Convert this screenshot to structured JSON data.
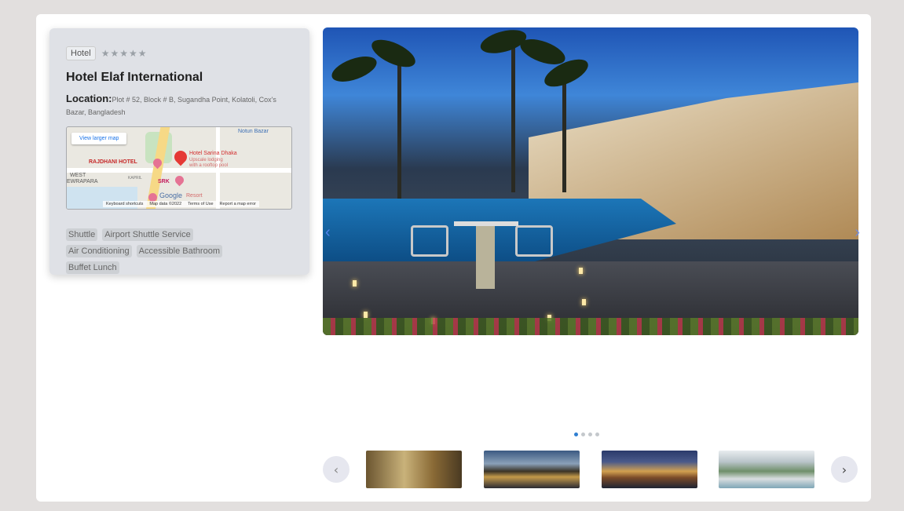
{
  "card": {
    "type_label": "Hotel",
    "stars": "★★★★★",
    "hotel_name": "Hotel Elaf International",
    "location_label": "Location:",
    "location_text": "Plot # 52, Block # B, Sugandha Point, Kolatoli, Cox's Bazar, Bangladesh",
    "map": {
      "view_larger_label": "View larger map",
      "labels": {
        "rajdhani": "RAJDHANI HOTEL",
        "sayeman_title": "Hotel Sarina Dhaka",
        "sayeman_sub1": "Upscale lodging",
        "sayeman_sub2": "with a rooftop pool",
        "srk": "SRK",
        "west": "WEST",
        "ewrapara": "EWRAPARA",
        "notun_bazar": "Notun Bazar",
        "kapril": "KAPRIL",
        "google": "Google",
        "resort": "Resort"
      },
      "footer": [
        "Keyboard shortcuts",
        "Map data ©2022",
        "Terms of Use",
        "Report a map error"
      ]
    },
    "amenities": [
      "Shuttle",
      "Airport Shuttle Service",
      "Air Conditioning",
      "Accessible Bathroom",
      "Buffet Lunch"
    ]
  },
  "gallery": {
    "prev_arrow": "‹",
    "next_arrow": "›",
    "slide_count": 4,
    "active_slide": 1,
    "thumb_prev": "‹",
    "thumb_next": "›"
  },
  "colors": {
    "page_bg": "#e2dfde",
    "card_bg": "#dfe1e6",
    "active_dot": "#2f7fd1",
    "map_pin": "#e53935"
  }
}
